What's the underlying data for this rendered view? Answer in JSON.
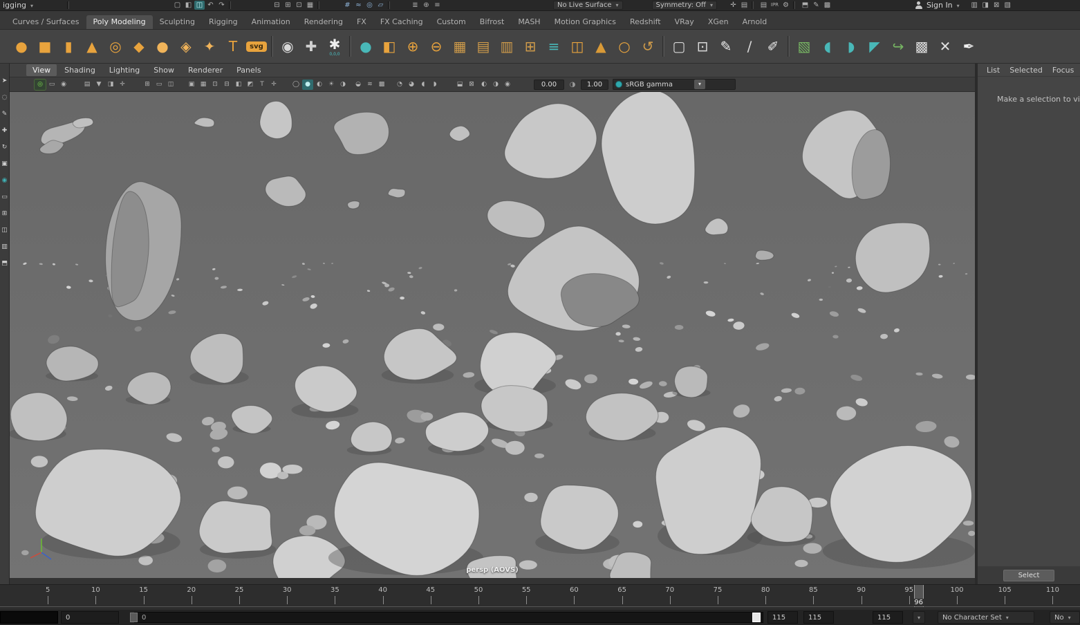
{
  "colors": {
    "accent_teal": "#3fb1b5",
    "accent_orange": "#e8a33d",
    "axis_x": "#d04a3a",
    "axis_y": "#6abe30",
    "axis_z": "#3a62c8",
    "viewport_bg": "#6e6e6e"
  },
  "status_line": {
    "workspace_label": "igging",
    "live_surface_label": "No Live Surface",
    "symmetry_label": "Symmetry: Off",
    "sign_in_label": "Sign In",
    "left_groups": [
      {
        "items": [
          {
            "n": "new-scene-icon",
            "g": "▢"
          },
          {
            "n": "open-scene-icon",
            "g": "◧"
          },
          {
            "n": "save-scene-icon",
            "g": "◫",
            "hl": true
          },
          {
            "n": "undo-icon",
            "g": "↶"
          },
          {
            "n": "redo-icon",
            "g": "↷"
          }
        ]
      },
      {
        "items": [
          {
            "n": "select-hierarchy-icon",
            "g": "⊟"
          },
          {
            "n": "select-object-icon",
            "g": "⊞"
          },
          {
            "n": "select-component-icon",
            "g": "⊡"
          },
          {
            "n": "selection-mask-icon",
            "g": "▦"
          }
        ]
      },
      {
        "items": [
          {
            "n": "snap-grid-icon",
            "g": "#",
            "blue": true
          },
          {
            "n": "snap-curve-icon",
            "g": "≈",
            "blue": true
          },
          {
            "n": "snap-point-icon",
            "g": "◎",
            "blue": true
          },
          {
            "n": "snap-plane-icon",
            "g": "▱",
            "blue": true
          }
        ]
      },
      {
        "items": [
          {
            "n": "construction-history-icon",
            "g": "≣"
          },
          {
            "n": "history-toggle-icon",
            "g": "⊕"
          },
          {
            "n": "list-inputs-icon",
            "g": "≡"
          }
        ]
      }
    ],
    "mid_groups": [
      {
        "items": [
          {
            "n": "highlight-selection-icon",
            "g": "✛"
          },
          {
            "n": "object-details-icon",
            "g": "▤"
          }
        ]
      },
      {
        "items": [
          {
            "n": "render-frame-icon",
            "g": "▤"
          },
          {
            "n": "ipr-render-icon",
            "g": "IPR"
          },
          {
            "n": "render-settings-icon",
            "g": "⚙"
          }
        ]
      },
      {
        "items": [
          {
            "n": "render-view-icon",
            "g": "⬒"
          },
          {
            "n": "paint-effects-icon",
            "g": "✎"
          },
          {
            "n": "texture-view-icon",
            "g": "▩"
          }
        ]
      }
    ],
    "right_groups": [
      {
        "items": [
          {
            "n": "workspace-grid-icon",
            "g": "▥"
          },
          {
            "n": "panel-layout-icon",
            "g": "◨"
          },
          {
            "n": "outliner-toggle-icon",
            "g": "⊠"
          },
          {
            "n": "tool-settings-icon",
            "g": "▧"
          }
        ]
      }
    ]
  },
  "shelf": {
    "tabs": [
      "Curves / Surfaces",
      "Poly Modeling",
      "Sculpting",
      "Rigging",
      "Animation",
      "Rendering",
      "FX",
      "FX Caching",
      "Custom",
      "Bifrost",
      "MASH",
      "Motion Graphics",
      "Redshift",
      "VRay",
      "XGen",
      "Arnold"
    ],
    "active_tab": "Poly Modeling",
    "icons": [
      {
        "n": "poly-sphere-icon",
        "g": "●",
        "c": "#e8a33d"
      },
      {
        "n": "poly-cube-icon",
        "g": "■",
        "c": "#e8a33d"
      },
      {
        "n": "poly-cylinder-icon",
        "g": "▮",
        "c": "#e8a33d"
      },
      {
        "n": "poly-cone-icon",
        "g": "▲",
        "c": "#e8a33d"
      },
      {
        "n": "poly-torus-icon",
        "g": "◎",
        "c": "#e8a33d"
      },
      {
        "n": "poly-plane-icon",
        "g": "◆",
        "c": "#e8a33d"
      },
      {
        "n": "poly-disc-icon",
        "g": "●",
        "c": "#f1b45a"
      },
      {
        "n": "platonic-solid-icon",
        "g": "◈",
        "c": "#f1b45a"
      },
      {
        "n": "super-shape-icon",
        "g": "✦",
        "c": "#f1b45a"
      },
      {
        "n": "type-tool-icon",
        "g": "T",
        "c": "#e8a33d"
      },
      {
        "n": "svg-tool-icon",
        "badge": "svg"
      },
      {
        "sep": true
      },
      {
        "n": "construction-aim-icon",
        "g": "◉",
        "c": "#d8d8d8"
      },
      {
        "n": "measure-tool-icon",
        "g": "✚",
        "c": "#d0d0d0"
      },
      {
        "n": "snap-origin-icon",
        "g": "✱",
        "c": "#eeeeee",
        "sub": "0,0,0"
      },
      {
        "sep": true
      },
      {
        "n": "smooth-mesh-icon",
        "g": "●",
        "c": "#49b8b8"
      },
      {
        "n": "combine-icon",
        "g": "◧",
        "c": "#e8a33d"
      },
      {
        "n": "boolean-union-icon",
        "g": "⊕",
        "c": "#e8a33d"
      },
      {
        "n": "boolean-difference-icon",
        "g": "⊖",
        "c": "#e8a33d"
      },
      {
        "n": "fill-hole-icon",
        "g": "▦",
        "c": "#cf9b4a"
      },
      {
        "n": "reduce-icon",
        "g": "▤",
        "c": "#cf9b4a"
      },
      {
        "n": "smooth-icon",
        "g": "▥",
        "c": "#cf9b4a"
      },
      {
        "n": "extrude-icon",
        "g": "⊞",
        "c": "#cf9b4a"
      },
      {
        "n": "stack-planes-icon",
        "g": "≡",
        "c": "#49b8b8"
      },
      {
        "n": "mirror-icon",
        "g": "◫",
        "c": "#e8a33d"
      },
      {
        "n": "wedge-icon",
        "g": "▲",
        "c": "#d99a37"
      },
      {
        "n": "sphere-wire-icon",
        "g": "○",
        "c": "#e8a33d"
      },
      {
        "n": "bend-deformer-icon",
        "g": "↺",
        "c": "#cf9b4a"
      },
      {
        "sep": true
      },
      {
        "n": "lattice-icon",
        "g": "▢",
        "c": "#d8d8d8"
      },
      {
        "n": "show-manipulator-icon",
        "g": "⊡",
        "c": "#d8d8d8"
      },
      {
        "n": "knife-tool-icon",
        "g": "✎",
        "c": "#ededed"
      },
      {
        "n": "multi-cut-icon",
        "g": "∕",
        "c": "#d8d8d8"
      },
      {
        "n": "quad-draw-icon",
        "g": "✐",
        "c": "#e8e8e8"
      },
      {
        "sep": true
      },
      {
        "n": "uv-editor-icon",
        "g": "▧",
        "c": "#77b663"
      },
      {
        "n": "sculpt-surface-icon",
        "g": "◖",
        "c": "#49b8b8"
      },
      {
        "n": "sculpt-grab-icon",
        "g": "◗",
        "c": "#49b8b8"
      },
      {
        "n": "sculpt-crease-icon",
        "g": "◤",
        "c": "#49b8b8"
      },
      {
        "n": "curve-warp-icon",
        "g": "↪",
        "c": "#77b663"
      },
      {
        "n": "checker-pattern-icon",
        "g": "▩",
        "c": "#d8d8d8"
      },
      {
        "n": "cut-cross-icon",
        "g": "✕",
        "c": "#e0e0e0"
      },
      {
        "n": "quill-icon",
        "g": "✒",
        "c": "#f0f0f0"
      }
    ]
  },
  "toolbox": {
    "items": [
      {
        "n": "select-tool-icon",
        "g": "➤"
      },
      {
        "n": "lasso-tool-icon",
        "g": "◌"
      },
      {
        "n": "paint-selection-tool-icon",
        "g": "✎"
      },
      {
        "n": "move-tool-icon",
        "g": "✚"
      },
      {
        "n": "rotate-tool-icon",
        "g": "↻"
      },
      {
        "n": "scale-tool-icon",
        "g": "▣"
      },
      {
        "n": "last-tool-icon",
        "g": "◉",
        "teal": true
      },
      {
        "n": "layout-single-pane-icon",
        "g": "▭"
      },
      {
        "n": "layout-four-pane-icon",
        "g": "⊞"
      },
      {
        "n": "layout-two-pane-icon",
        "g": "◫"
      },
      {
        "n": "layout-persp-outliner-icon",
        "g": "▥"
      },
      {
        "n": "layout-hypershade-icon",
        "g": "⬒"
      }
    ]
  },
  "viewport": {
    "menus": [
      "View",
      "Shading",
      "Lighting",
      "Show",
      "Renderer",
      "Panels"
    ],
    "active_menu": "View",
    "toolbar": {
      "exposure": "0.00",
      "gamma": "1.00",
      "view_transform": "sRGB gamma"
    },
    "camera_label": "persp (AOVS)",
    "toolbar_groups": [
      {
        "items": [
          {
            "n": "grease-pencil-icon",
            "g": "◎",
            "hl": "green"
          },
          {
            "n": "camera-select-icon",
            "g": "▭"
          },
          {
            "n": "camera-lock-icon",
            "g": "◉"
          }
        ]
      },
      {
        "items": [
          {
            "n": "camera-attributes-icon",
            "g": "▤"
          },
          {
            "n": "bookmarks-icon",
            "g": "▼"
          },
          {
            "n": "image-plane-icon",
            "g": "◨"
          },
          {
            "n": "pan-zoom-2d-icon",
            "g": "✛"
          }
        ]
      },
      {
        "items": [
          {
            "n": "grid-toggle-icon",
            "g": "⊞"
          },
          {
            "n": "film-gate-icon",
            "g": "▭"
          },
          {
            "n": "resolution-gate-icon",
            "g": "◫"
          }
        ]
      },
      {
        "items": [
          {
            "n": "gate-mask-icon",
            "g": "▣"
          },
          {
            "n": "field-chart-icon",
            "g": "▦"
          },
          {
            "n": "safe-action-icon",
            "g": "⊡"
          },
          {
            "n": "safe-title-icon",
            "g": "⊟"
          },
          {
            "n": "frame-all-icon",
            "g": "◧"
          },
          {
            "n": "frame-selection-icon",
            "g": "◩"
          },
          {
            "n": "hud-text-icon",
            "g": "T"
          },
          {
            "n": "axis-toggle-icon",
            "g": "✛"
          }
        ]
      },
      {
        "items": [
          {
            "n": "wireframe-mode-icon",
            "g": "◯"
          },
          {
            "n": "shaded-mode-icon",
            "g": "●",
            "hl": "teal"
          },
          {
            "n": "textured-mode-icon",
            "g": "◐"
          },
          {
            "n": "all-lights-icon",
            "g": "☀"
          },
          {
            "n": "shadows-icon",
            "g": "◑"
          }
        ]
      },
      {
        "items": [
          {
            "n": "ambient-occlusion-icon",
            "g": "◒"
          },
          {
            "n": "motion-blur-icon",
            "g": "≋"
          },
          {
            "n": "multisample-icon",
            "g": "▩"
          }
        ]
      },
      {
        "items": [
          {
            "n": "isolate-select-icon",
            "g": "◔"
          },
          {
            "n": "xray-icon",
            "g": "◕"
          },
          {
            "n": "wireframe-on-shaded-icon",
            "g": "◖"
          },
          {
            "n": "default-material-icon",
            "g": "◗"
          }
        ]
      },
      {
        "items": [
          {
            "n": "plugin-shading-icon",
            "g": "⬓"
          },
          {
            "n": "hud-toggle-icon",
            "g": "⊠"
          }
        ]
      },
      {
        "items": [
          {
            "n": "exposure-toggle-icon",
            "g": "◐"
          },
          {
            "n": "gamma-toggle-icon",
            "g": "◑"
          },
          {
            "n": "color-management-icon",
            "g": "◉"
          }
        ]
      }
    ]
  },
  "attribute_editor": {
    "tabs": [
      "List",
      "Selected",
      "Focus"
    ],
    "empty_hint": "Make a selection to view",
    "select_button": "Select"
  },
  "timeline": {
    "labels": [
      5,
      10,
      15,
      20,
      25,
      30,
      35,
      40,
      45,
      50,
      55,
      60,
      65,
      70,
      75,
      80,
      85,
      90,
      95,
      100,
      105,
      110
    ],
    "current_frame": 96
  },
  "range_slider": {
    "start_field": "0",
    "track_start_label": "0",
    "range_end_field": "115",
    "playback_end_field": "115",
    "animation_end_field": "115",
    "character_set_label": "No Character Set",
    "character_set_partial": "No"
  },
  "scene": {
    "speck_seed": 77,
    "rocks": [
      [
        75,
        60,
        38,
        14,
        -18,
        "#b5b5b5",
        11,
        0
      ],
      [
        106,
        44,
        17,
        8,
        -8,
        "#c0c0c0",
        12,
        0
      ],
      [
        60,
        80,
        20,
        9,
        -15,
        "#a8a8a8",
        13,
        0
      ],
      [
        282,
        44,
        15,
        7,
        4,
        "#bdbdbd",
        14,
        0
      ],
      [
        386,
        40,
        26,
        27,
        0,
        "#c6c6c6",
        15,
        0
      ],
      [
        508,
        56,
        41,
        33,
        -6,
        "#b2b2b2",
        16,
        0
      ],
      [
        650,
        60,
        16,
        12,
        8,
        "#c0c0c0",
        17,
        0
      ],
      [
        560,
        146,
        13,
        7,
        0,
        "#b6b6b6",
        18,
        0
      ],
      [
        497,
        163,
        11,
        6,
        0,
        "#b2b2b2",
        19,
        0
      ],
      [
        400,
        142,
        29,
        22,
        12,
        "#bababa",
        20,
        0
      ],
      [
        196,
        225,
        55,
        106,
        6,
        "#a6a6a6",
        21,
        0
      ],
      [
        172,
        232,
        30,
        96,
        6,
        "#8d8d8d",
        22,
        0
      ],
      [
        788,
        72,
        79,
        57,
        -4,
        "#c8c8c8",
        23,
        0
      ],
      [
        926,
        100,
        73,
        94,
        3,
        "#cdcdcd",
        24,
        0
      ],
      [
        731,
        186,
        45,
        28,
        10,
        "#bebebe",
        25,
        0
      ],
      [
        1022,
        196,
        18,
        13,
        0,
        "#c2c2c2",
        26,
        0
      ],
      [
        1208,
        92,
        67,
        62,
        5,
        "#c5c5c5",
        27,
        0
      ],
      [
        1248,
        108,
        28,
        50,
        8,
        "#9c9c9c",
        28,
        0
      ],
      [
        1278,
        242,
        64,
        59,
        -8,
        "#c0c0c0",
        29,
        0
      ],
      [
        810,
        268,
        95,
        74,
        -3,
        "#c4c4c4",
        30,
        0
      ],
      [
        852,
        300,
        60,
        40,
        5,
        "#888888",
        31,
        0
      ],
      [
        1091,
        237,
        16,
        8,
        0,
        "#aeaeae",
        32,
        0
      ],
      [
        90,
        392,
        40,
        26,
        -8,
        "#b6b6b6",
        33,
        1
      ],
      [
        200,
        428,
        34,
        24,
        3,
        "#bbbbbb",
        34,
        1
      ],
      [
        303,
        386,
        45,
        37,
        -6,
        "#bebebe",
        35,
        1
      ],
      [
        590,
        380,
        55,
        41,
        5,
        "#c6c6c6",
        36,
        1
      ],
      [
        456,
        432,
        51,
        39,
        4,
        "#cacaca",
        37,
        1
      ],
      [
        731,
        390,
        62,
        48,
        -5,
        "#d0d0d0",
        38,
        1
      ],
      [
        737,
        458,
        51,
        32,
        3,
        "#c7c7c7",
        39,
        1
      ],
      [
        40,
        470,
        44,
        34,
        5,
        "#c0c0c0",
        40,
        1
      ],
      [
        350,
        472,
        29,
        21,
        0,
        "#c4c4c4",
        41,
        1
      ],
      [
        520,
        500,
        34,
        25,
        0,
        "#c7c7c7",
        42,
        1
      ],
      [
        646,
        492,
        43,
        33,
        -4,
        "#cdcdcd",
        43,
        1
      ],
      [
        886,
        466,
        51,
        38,
        6,
        "#c2c2c2",
        44,
        1
      ],
      [
        986,
        420,
        29,
        21,
        0,
        "#bababa",
        45,
        1
      ],
      [
        330,
        630,
        58,
        44,
        0,
        "#cacaca",
        46,
        1
      ],
      [
        146,
        592,
        106,
        82,
        -4,
        "#cecece",
        47,
        1
      ],
      [
        430,
        682,
        54,
        40,
        0,
        "#d0d0d0",
        48,
        1
      ],
      [
        573,
        614,
        118,
        83,
        3,
        "#d4d4d4",
        49,
        1
      ],
      [
        821,
        612,
        64,
        55,
        -5,
        "#c9c9c9",
        50,
        1
      ],
      [
        700,
        692,
        38,
        28,
        0,
        "#c4c4c4",
        51,
        1
      ],
      [
        1013,
        576,
        80,
        92,
        4,
        "#cecece",
        52,
        1
      ],
      [
        900,
        692,
        33,
        26,
        0,
        "#bebebe",
        53,
        1
      ],
      [
        1116,
        614,
        52,
        42,
        6,
        "#c6c6c6",
        54,
        1
      ],
      [
        1286,
        602,
        116,
        86,
        -3,
        "#d2d2d2",
        55,
        1
      ]
    ]
  }
}
